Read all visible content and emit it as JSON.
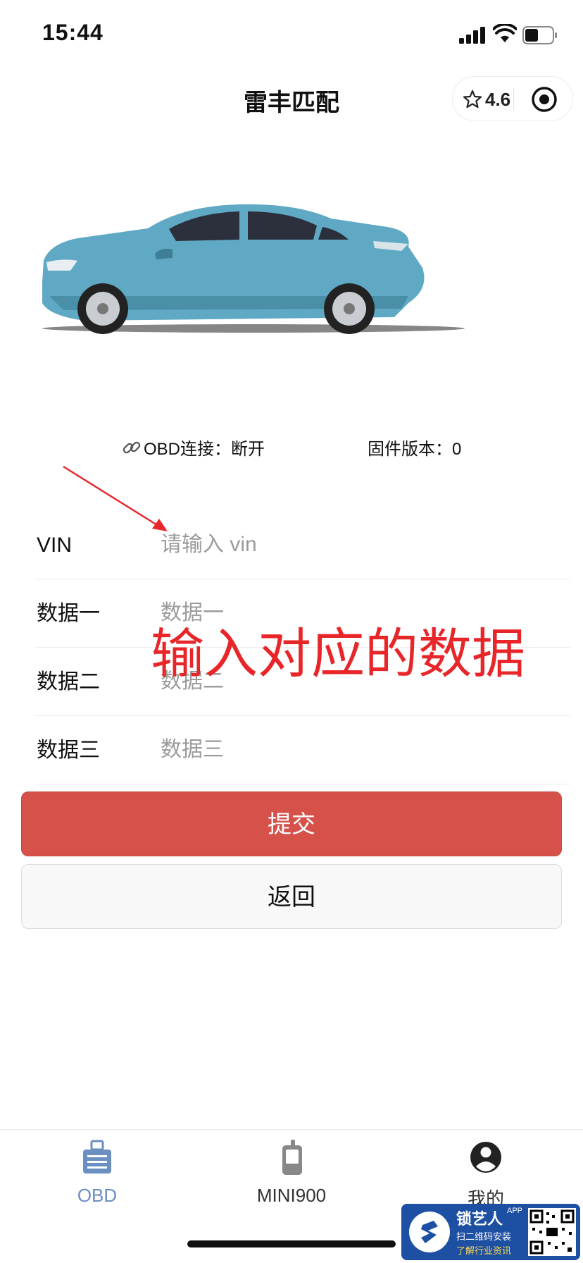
{
  "status_bar": {
    "time": "15:44"
  },
  "nav": {
    "title": "雷丰匹配",
    "rating": "4.6"
  },
  "connection": {
    "obd_label": "OBD连接：断开",
    "firmware_label": "固件版本：0"
  },
  "annotation": {
    "text": "输入对应的数据",
    "color": "#e8262a"
  },
  "form": {
    "fields": [
      {
        "label": "VIN",
        "placeholder": "请输入 vin"
      },
      {
        "label": "数据一",
        "placeholder": "数据一"
      },
      {
        "label": "数据二",
        "placeholder": "数据二"
      },
      {
        "label": "数据三",
        "placeholder": "数据三"
      }
    ]
  },
  "buttons": {
    "submit": "提交",
    "back": "返回"
  },
  "tabbar": {
    "tabs": [
      {
        "label": "OBD",
        "icon": "obd-device-icon",
        "active": true
      },
      {
        "label": "MINI900",
        "icon": "handheld-device-icon",
        "active": false
      },
      {
        "label": "我的",
        "icon": "user-profile-icon",
        "active": false
      }
    ]
  },
  "watermark": {
    "title": "锁艺人",
    "badge": "APP",
    "line1": "扫二维码安装",
    "line2": "了解行业资讯"
  },
  "colors": {
    "accent": "#d6514a",
    "tab_active": "#6a8fc0",
    "car_body": "#5fa9c4"
  }
}
